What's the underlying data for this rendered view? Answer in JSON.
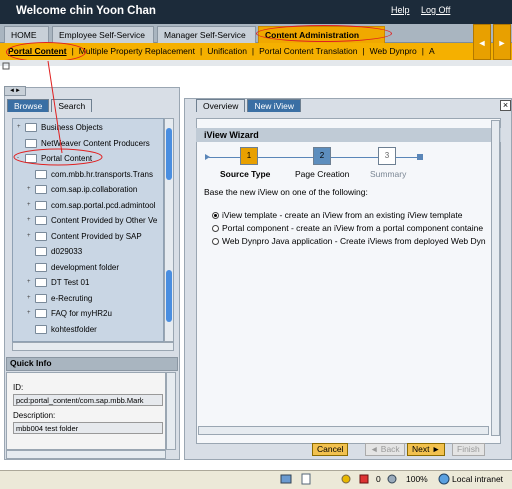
{
  "header": {
    "welcome": "Welcome chin Yoon Chan",
    "help": "Help",
    "logoff": "Log Off"
  },
  "top_tabs": [
    {
      "label": "HOME"
    },
    {
      "label": "Employee Self-Service"
    },
    {
      "label": "Manager Self-Service"
    },
    {
      "label": "Content Administration",
      "active": true
    }
  ],
  "sub_tabs": [
    {
      "label": "Portal Content",
      "active": true
    },
    {
      "label": "Multiple Property Replacement"
    },
    {
      "label": "Unification"
    },
    {
      "label": "Portal Content Translation"
    },
    {
      "label": "Web Dynpro"
    },
    {
      "label": "A"
    }
  ],
  "left_panel": {
    "tabs": [
      "Browse",
      "Search"
    ],
    "tree": [
      {
        "label": "Business Objects",
        "expand": "+"
      },
      {
        "label": "NetWeaver Content Producers",
        "expand": ""
      },
      {
        "label": "Portal Content",
        "expand": "-"
      },
      {
        "label": "com.mbb.hr.transports.Trans",
        "expand": ""
      },
      {
        "label": "com.sap.ip.collaboration",
        "expand": "+"
      },
      {
        "label": "com.sap.portal.pcd.admintool",
        "expand": "+"
      },
      {
        "label": "Content Provided by Other Ve",
        "expand": "+"
      },
      {
        "label": "Content Provided by SAP",
        "expand": "+"
      },
      {
        "label": "d029033",
        "expand": ""
      },
      {
        "label": "development folder",
        "expand": ""
      },
      {
        "label": "DT Test 01",
        "expand": "+"
      },
      {
        "label": "e-Recruting",
        "expand": "+"
      },
      {
        "label": "FAQ for myHR2u",
        "expand": "+"
      },
      {
        "label": "kohtestfolder",
        "expand": ""
      }
    ],
    "quick_info": {
      "title": "Quick Info",
      "id_label": "ID:",
      "id_value": "pcd:portal_content/com.sap.mbb.Mark",
      "desc_label": "Description:",
      "desc_value": "mbb004 test folder"
    }
  },
  "right_panel": {
    "tabs": [
      "Overview",
      "New iView"
    ],
    "close": "×",
    "wizard": {
      "title": "iView Wizard",
      "steps": [
        {
          "num": "1",
          "label": "Source Type",
          "state": "current"
        },
        {
          "num": "2",
          "label": "Page Creation",
          "state": "pending"
        },
        {
          "num": "3",
          "label": "Summary",
          "state": "disabled"
        }
      ],
      "instruction": "Base the new iView on one of the following:",
      "options": [
        {
          "label": "iView template - create an iView from an existing iView template",
          "selected": true
        },
        {
          "label": "Portal component - create an iView from a portal component containe",
          "selected": false
        },
        {
          "label": "Web Dynpro Java application - Create iViews from deployed Web Dyn",
          "selected": false
        }
      ],
      "buttons": {
        "cancel": "Cancel",
        "back": "◄ Back",
        "next": "Next ►",
        "finish": "Finish"
      }
    }
  },
  "statusbar": {
    "popup_count": "0",
    "zoom": "100%",
    "zone": "Local intranet"
  },
  "nav_arrows": {
    "left": "◄",
    "right": "►"
  }
}
